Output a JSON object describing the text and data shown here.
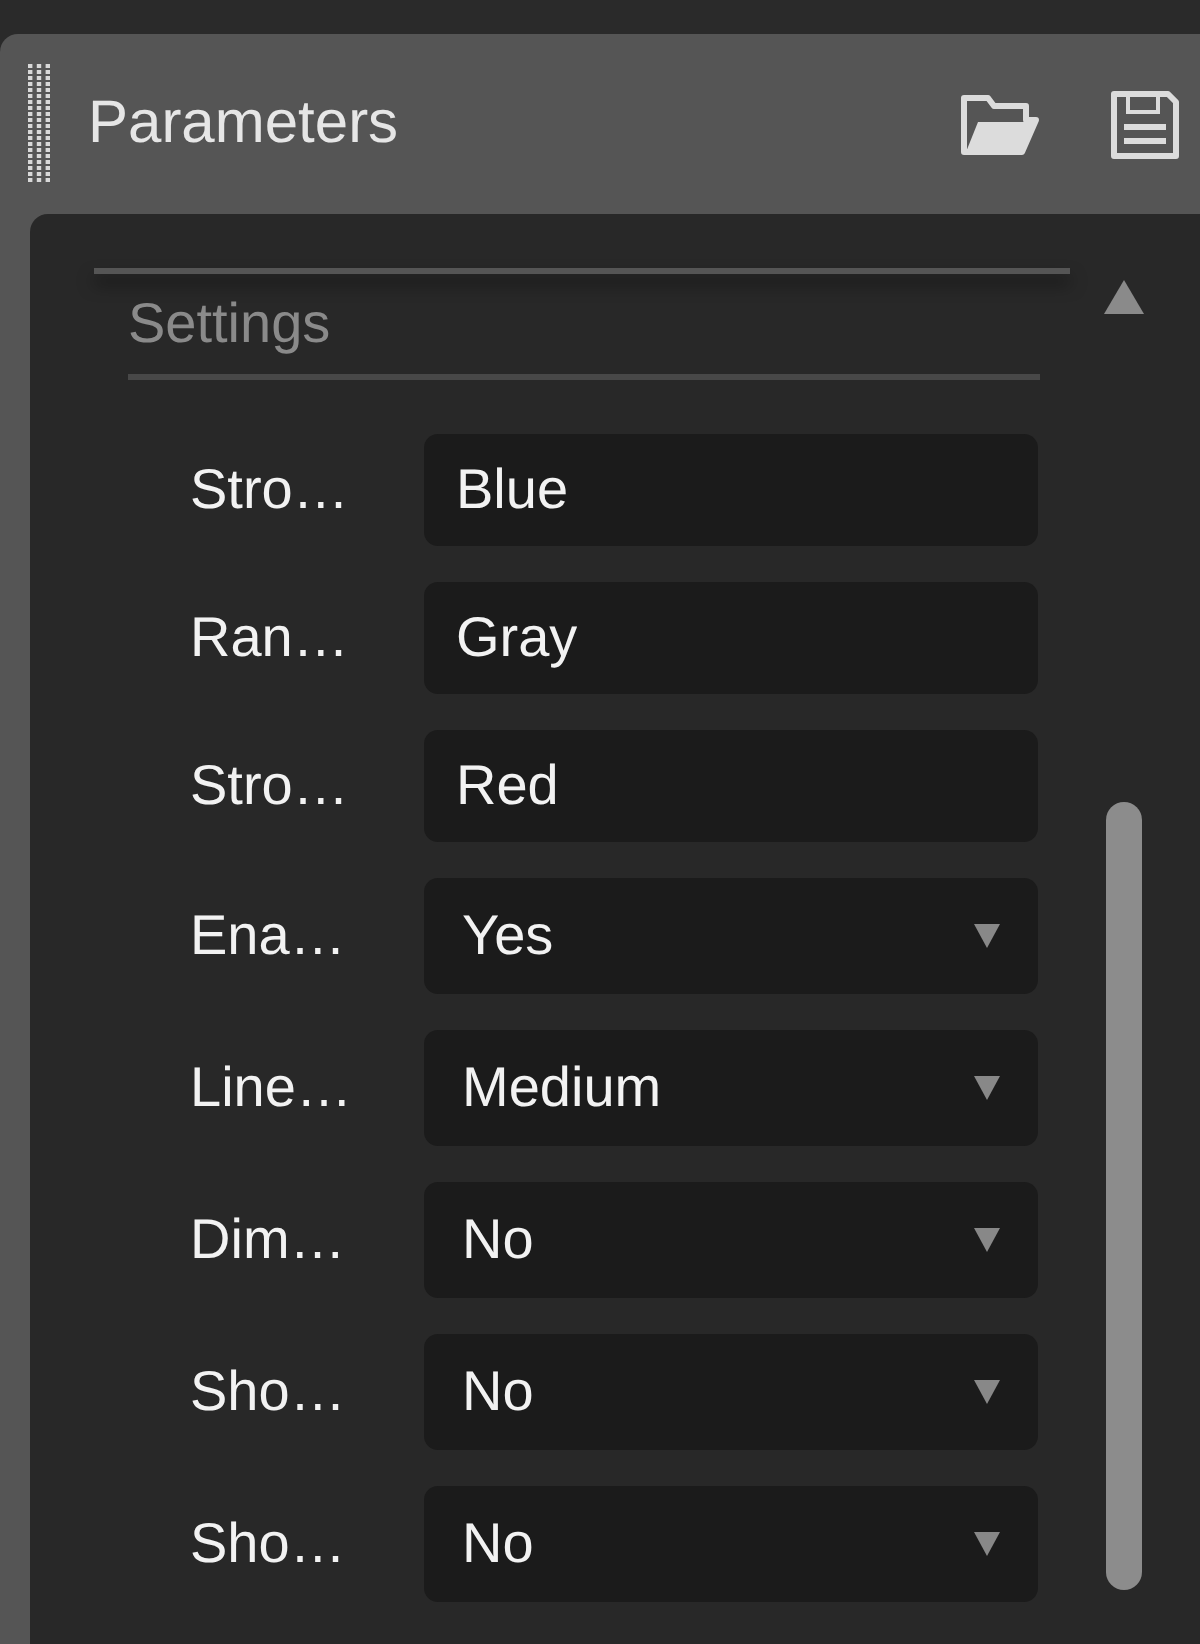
{
  "panel": {
    "title": "Parameters"
  },
  "section": {
    "title": "Settings",
    "expanded": true
  },
  "fields": [
    {
      "label": "Stro…",
      "kind": "text",
      "value": "Blue"
    },
    {
      "label": "Ran…",
      "kind": "text",
      "value": "Gray"
    },
    {
      "label": "Stro…",
      "kind": "text",
      "value": "Red"
    },
    {
      "label": "Ena…",
      "kind": "select",
      "value": "Yes"
    },
    {
      "label": "Line…",
      "kind": "select",
      "value": "Medium"
    },
    {
      "label": "Dim…",
      "kind": "select",
      "value": "No"
    },
    {
      "label": "Sho…",
      "kind": "select",
      "value": "No"
    },
    {
      "label": "Sho…",
      "kind": "select",
      "value": "No"
    }
  ]
}
